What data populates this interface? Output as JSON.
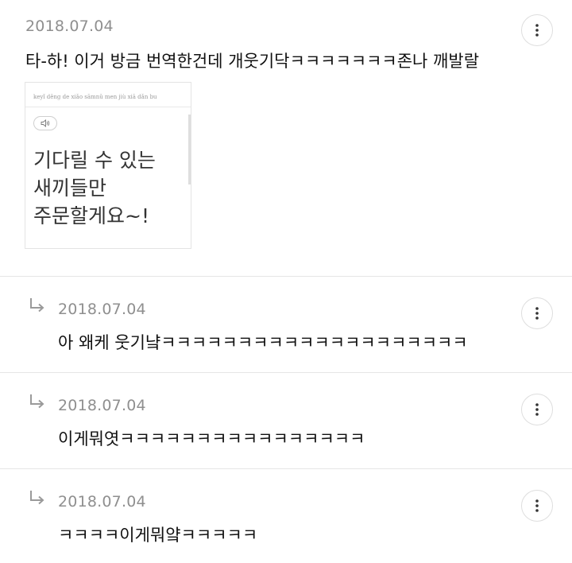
{
  "comments": [
    {
      "date": "2018.07.04",
      "text": "타-하! 이거 방금 번역한건데 개웃기닥ㅋㅋㅋㅋㅋㅋㅋ존나 깨발랄",
      "image": {
        "pinyin": "keyǐ děng de xiǎo sāmnǔ men jiù xiā dǎn bu",
        "lines": [
          "기다릴 수 있는",
          "새끼들만",
          "주문할게요~!"
        ],
        "speaker_icon": "speaker-icon"
      },
      "more_icon": "vertical-ellipsis-icon"
    }
  ],
  "replies": [
    {
      "date": "2018.07.04",
      "text": "아 왜케 웃기냨ㅋㅋㅋㅋㅋㅋㅋㅋㅋㅋㅋㅋㅋㅋㅋㅋㅋㅋㅋㅋ",
      "arrow_icon": "reply-arrow-icon",
      "more_icon": "vertical-ellipsis-icon"
    },
    {
      "date": "2018.07.04",
      "text": "이게뭐엿ㅋㅋㅋㅋㅋㅋㅋㅋㅋㅋㅋㅋㅋㅋㅋㅋ",
      "arrow_icon": "reply-arrow-icon",
      "more_icon": "vertical-ellipsis-icon"
    },
    {
      "date": "2018.07.04",
      "text": "ㅋㅋㅋㅋ이게뭐얔ㅋㅋㅋㅋㅋ",
      "arrow_icon": "reply-arrow-icon",
      "more_icon": "vertical-ellipsis-icon"
    }
  ],
  "colors": {
    "date": "#8f8f8f",
    "text": "#111111",
    "divider": "#e6e6e6",
    "button_border": "#dedede"
  }
}
